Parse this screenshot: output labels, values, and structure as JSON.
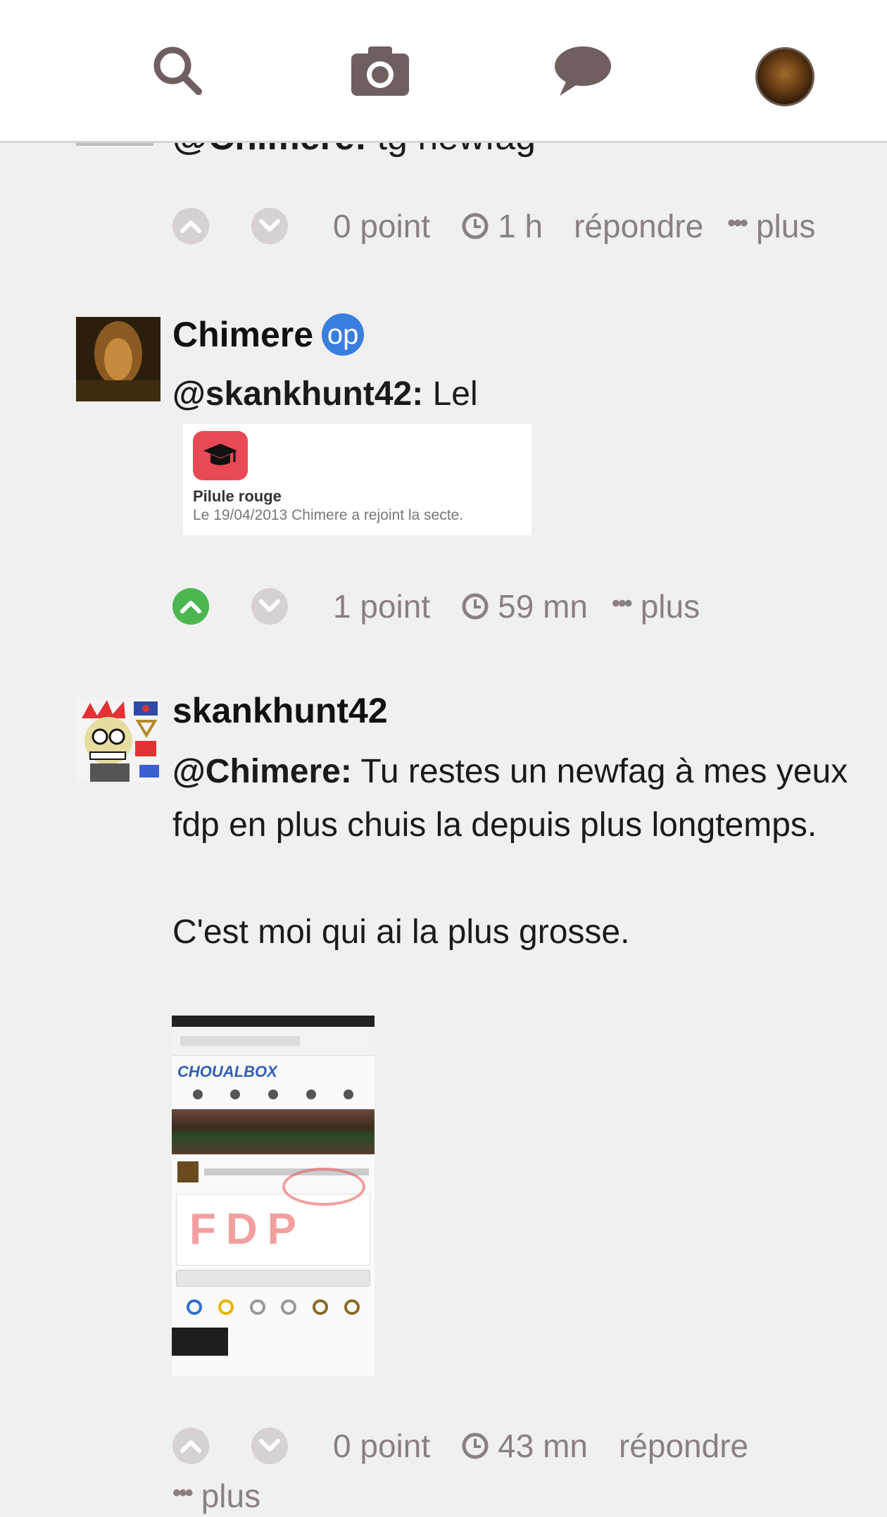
{
  "topbar": {
    "icons": [
      "search-icon",
      "camera-icon",
      "chat-bubble-icon",
      "user-avatar"
    ]
  },
  "clipped_comment": {
    "mention": "@Chimere:",
    "text": "tg newfag",
    "actions": {
      "points": "0 point",
      "time": "1 h",
      "reply": "répondre",
      "more": "plus"
    }
  },
  "comment_chimere": {
    "username": "Chimere",
    "badge": "op",
    "mention": "@skankhunt42:",
    "text": "Lel",
    "embed": {
      "title": "Pilule rouge",
      "description": "Le 19/04/2013 Chimere a rejoint la secte."
    },
    "actions": {
      "points": "1 point",
      "time": "59 mn",
      "more": "plus",
      "upvoted": true
    }
  },
  "comment_skank": {
    "username": "skankhunt42",
    "mention": "@Chimere:",
    "text1": "Tu restes un newfag à mes yeux fdp en plus chuis la depuis plus longtemps.",
    "text2": "C'est moi qui ai la plus grosse.",
    "screenshot_overlay": "FDP",
    "actions": {
      "points": "0 point",
      "time": "43 mn",
      "reply": "répondre",
      "more": "plus"
    }
  },
  "colors": {
    "background": "#f0f0f0",
    "icon_grey": "#6f5f5f",
    "upvote_green": "#4cb651",
    "op_blue": "#3a7ee0",
    "meta_text": "#8a8080"
  }
}
